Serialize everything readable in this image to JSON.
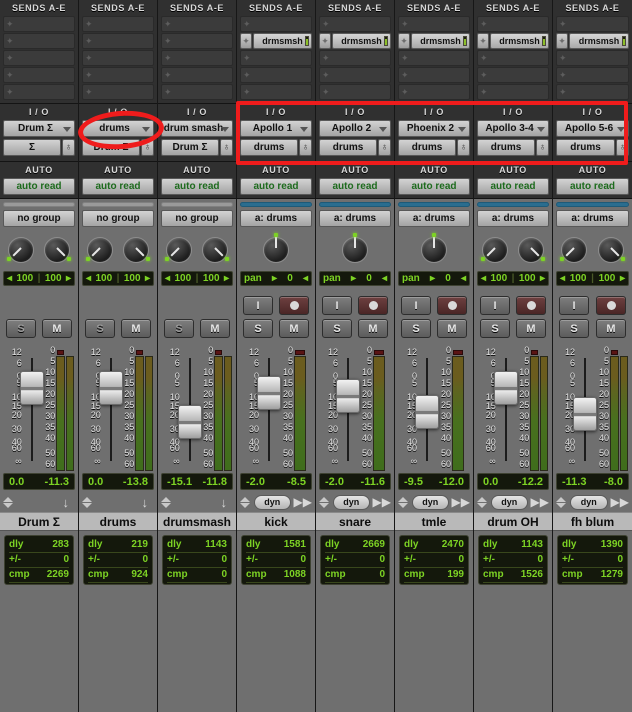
{
  "section_titles": {
    "sends": "SENDS A-E",
    "io": "I / O",
    "auto": "AUTO"
  },
  "labels": {
    "auto_mode": "auto read",
    "no_group": "no group",
    "group_drums": "a: drums",
    "pan_label": "pan",
    "dly": "dly",
    "plusminus": "+/-",
    "cmp": "cmp",
    "dyn": "dyn",
    "solo": "S",
    "mute": "M",
    "input_monitor": "I",
    "record_arm": "record-dot",
    "send_slot_name": "drmsmsh",
    "pan_value_mono": "0",
    "pan_value_left": "100",
    "pan_value_right": "100"
  },
  "colors": {
    "annotation_red": "#ef1c1c",
    "lcd_green": "#7dd324",
    "auto_text_green": "#1d6b1d",
    "group_bar_active": "#2a6d8f",
    "strip_gray": "#6f6f6f",
    "header_dark": "#303030"
  },
  "fader_scale": [
    "12",
    "6",
    "0",
    "5",
    "10",
    "15",
    "20",
    "30",
    "40",
    "60",
    "∞"
  ],
  "meter_scale": [
    "0",
    "5",
    "10",
    "15",
    "20",
    "25",
    "30",
    "35",
    "40",
    "50",
    "60"
  ],
  "annotations": {
    "ellipse_target": "drums-io-output-selector",
    "box_target": "io-input-output-selectors-channels-4-8"
  },
  "channels": [
    {
      "name": "Drum Σ",
      "sends": [
        "",
        "",
        "",
        "",
        ""
      ],
      "io_out": "Drum Σ",
      "io_in": "Σ",
      "auto": "auto read",
      "group": "no group",
      "group_active": false,
      "pan_type": "stereo",
      "pan_left": "100",
      "pan_right": "100",
      "has_record": false,
      "meter_bars": 2,
      "fader_db": "0.0",
      "peak_db": "-11.3",
      "fader_pos": 0.225,
      "has_dyn": false,
      "dly": "283",
      "offset": "0",
      "cmp": "2269"
    },
    {
      "name": "drums",
      "sends": [
        "",
        "",
        "",
        "",
        ""
      ],
      "io_out": "drums",
      "io_in": "Drum Σ",
      "auto": "auto read",
      "group": "no group",
      "group_active": false,
      "pan_type": "stereo",
      "pan_left": "100",
      "pan_right": "100",
      "has_record": false,
      "meter_bars": 2,
      "fader_db": "0.0",
      "peak_db": "-13.8",
      "fader_pos": 0.225,
      "has_dyn": false,
      "dly": "219",
      "offset": "0",
      "cmp": "924"
    },
    {
      "name": "drumsmash",
      "sends": [
        "",
        "",
        "",
        "",
        ""
      ],
      "io_out": "drum smash",
      "io_in": "Drum Σ",
      "auto": "auto read",
      "group": "no group",
      "group_active": false,
      "pan_type": "stereo",
      "pan_left": "100",
      "pan_right": "100",
      "has_record": false,
      "meter_bars": 2,
      "fader_db": "-15.1",
      "peak_db": "-11.8",
      "fader_pos": 0.5,
      "has_dyn": false,
      "dly": "1143",
      "offset": "0",
      "cmp": "0"
    },
    {
      "name": "kick",
      "sends": [
        "",
        "drmsmsh",
        "",
        "",
        ""
      ],
      "io_out": "Apollo 1",
      "io_in": "drums",
      "auto": "auto read",
      "group": "a: drums",
      "group_active": true,
      "pan_type": "mono",
      "pan_value": "0",
      "has_record": true,
      "meter_bars": 1,
      "fader_db": "-2.0",
      "peak_db": "-8.5",
      "fader_pos": 0.27,
      "has_dyn": true,
      "dly": "1581",
      "offset": "0",
      "cmp": "1088"
    },
    {
      "name": "snare",
      "sends": [
        "",
        "drmsmsh",
        "",
        "",
        ""
      ],
      "io_out": "Apollo 2",
      "io_in": "drums",
      "auto": "auto read",
      "group": "a: drums",
      "group_active": true,
      "pan_type": "mono",
      "pan_value": "0",
      "has_record": true,
      "meter_bars": 1,
      "fader_db": "-2.0",
      "peak_db": "-11.6",
      "fader_pos": 0.29,
      "has_dyn": true,
      "dly": "2669",
      "offset": "0",
      "cmp": "0"
    },
    {
      "name": "tmle",
      "sends": [
        "",
        "drmsmsh",
        "",
        "",
        ""
      ],
      "io_out": "Phoenix 2",
      "io_in": "drums",
      "auto": "auto read",
      "group": "a: drums",
      "group_active": true,
      "pan_type": "mono",
      "pan_value": "0",
      "has_record": true,
      "meter_bars": 1,
      "fader_db": "-9.5",
      "peak_db": "-12.0",
      "fader_pos": 0.42,
      "has_dyn": true,
      "dly": "2470",
      "offset": "0",
      "cmp": "199"
    },
    {
      "name": "drum OH",
      "sends": [
        "",
        "drmsmsh",
        "",
        "",
        ""
      ],
      "io_out": "Apollo 3-4",
      "io_in": "drums",
      "auto": "auto read",
      "group": "a: drums",
      "group_active": true,
      "pan_type": "stereo",
      "pan_left": "100",
      "pan_right": "100",
      "has_record": true,
      "meter_bars": 2,
      "fader_db": "0.0",
      "peak_db": "-12.2",
      "fader_pos": 0.225,
      "has_dyn": true,
      "dly": "1143",
      "offset": "0",
      "cmp": "1526"
    },
    {
      "name": "fh blum",
      "sends": [
        "",
        "drmsmsh",
        "",
        "",
        ""
      ],
      "io_out": "Apollo 5-6",
      "io_in": "drums",
      "auto": "auto read",
      "group": "a: drums",
      "group_active": true,
      "pan_type": "stereo",
      "pan_left": "100",
      "pan_right": "100",
      "has_record": true,
      "meter_bars": 2,
      "fader_db": "-11.3",
      "peak_db": "-8.0",
      "fader_pos": 0.44,
      "has_dyn": true,
      "dly": "1390",
      "offset": "0",
      "cmp": "1279"
    }
  ]
}
